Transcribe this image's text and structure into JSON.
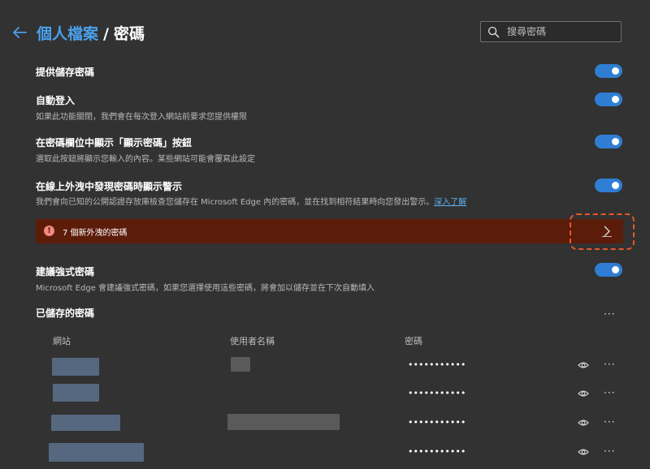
{
  "header": {
    "back_icon": "arrow-left-icon",
    "breadcrumb_parent": "個人檔案",
    "breadcrumb_separator": "/",
    "breadcrumb_current": "密碼"
  },
  "search": {
    "icon": "search-icon",
    "placeholder": "搜尋密碼"
  },
  "settings": {
    "offer_save": {
      "title": "提供儲存密碼",
      "enabled": true
    },
    "auto_signin": {
      "title": "自動登入",
      "desc": "如果此功能關閉，我們會在每次登入網站前要求您提供權限",
      "enabled": true
    },
    "reveal_button": {
      "title": "在密碼欄位中顯示「顯示密碼」按鈕",
      "desc": "選取此按鈕將顯示您輸入的內容。某些網站可能會覆寫此設定",
      "enabled": true
    },
    "leak_alert": {
      "title": "在線上外洩中發現密碼時顯示警示",
      "desc": "我們會向已知的公開認證存放庫檢查您儲存在 Microsoft Edge 內的密碼，並在找到相符結果時向您發出警示。",
      "learn_more": "深入了解",
      "enabled": true
    },
    "strong_password": {
      "title": "建議強式密碼",
      "desc": "Microsoft Edge 會建議強式密碼，如果您選擇使用這些密碼，將會加以儲存並在下次自動填入",
      "enabled": true
    }
  },
  "alert": {
    "icon": "exclamation-icon",
    "text": "7 個新外洩的密碼",
    "chevron": "chevron-right-icon",
    "color": "#5c1c0a",
    "highlight_color": "#e8572a"
  },
  "saved": {
    "title": "已儲存的密碼",
    "more": "···",
    "columns": {
      "site": "網站",
      "username": "使用者名稱",
      "password": "密碼"
    },
    "rows": [
      {
        "password": "•••••••••••",
        "more": "···"
      },
      {
        "password": "•••••••••••",
        "more": "···"
      },
      {
        "password": "•••••••••••",
        "more": "···"
      },
      {
        "password": "•••••••••••",
        "more": "···"
      }
    ]
  },
  "colors": {
    "background": "#323232",
    "accent": "#2f7ed3",
    "link": "#4aa0ec"
  }
}
